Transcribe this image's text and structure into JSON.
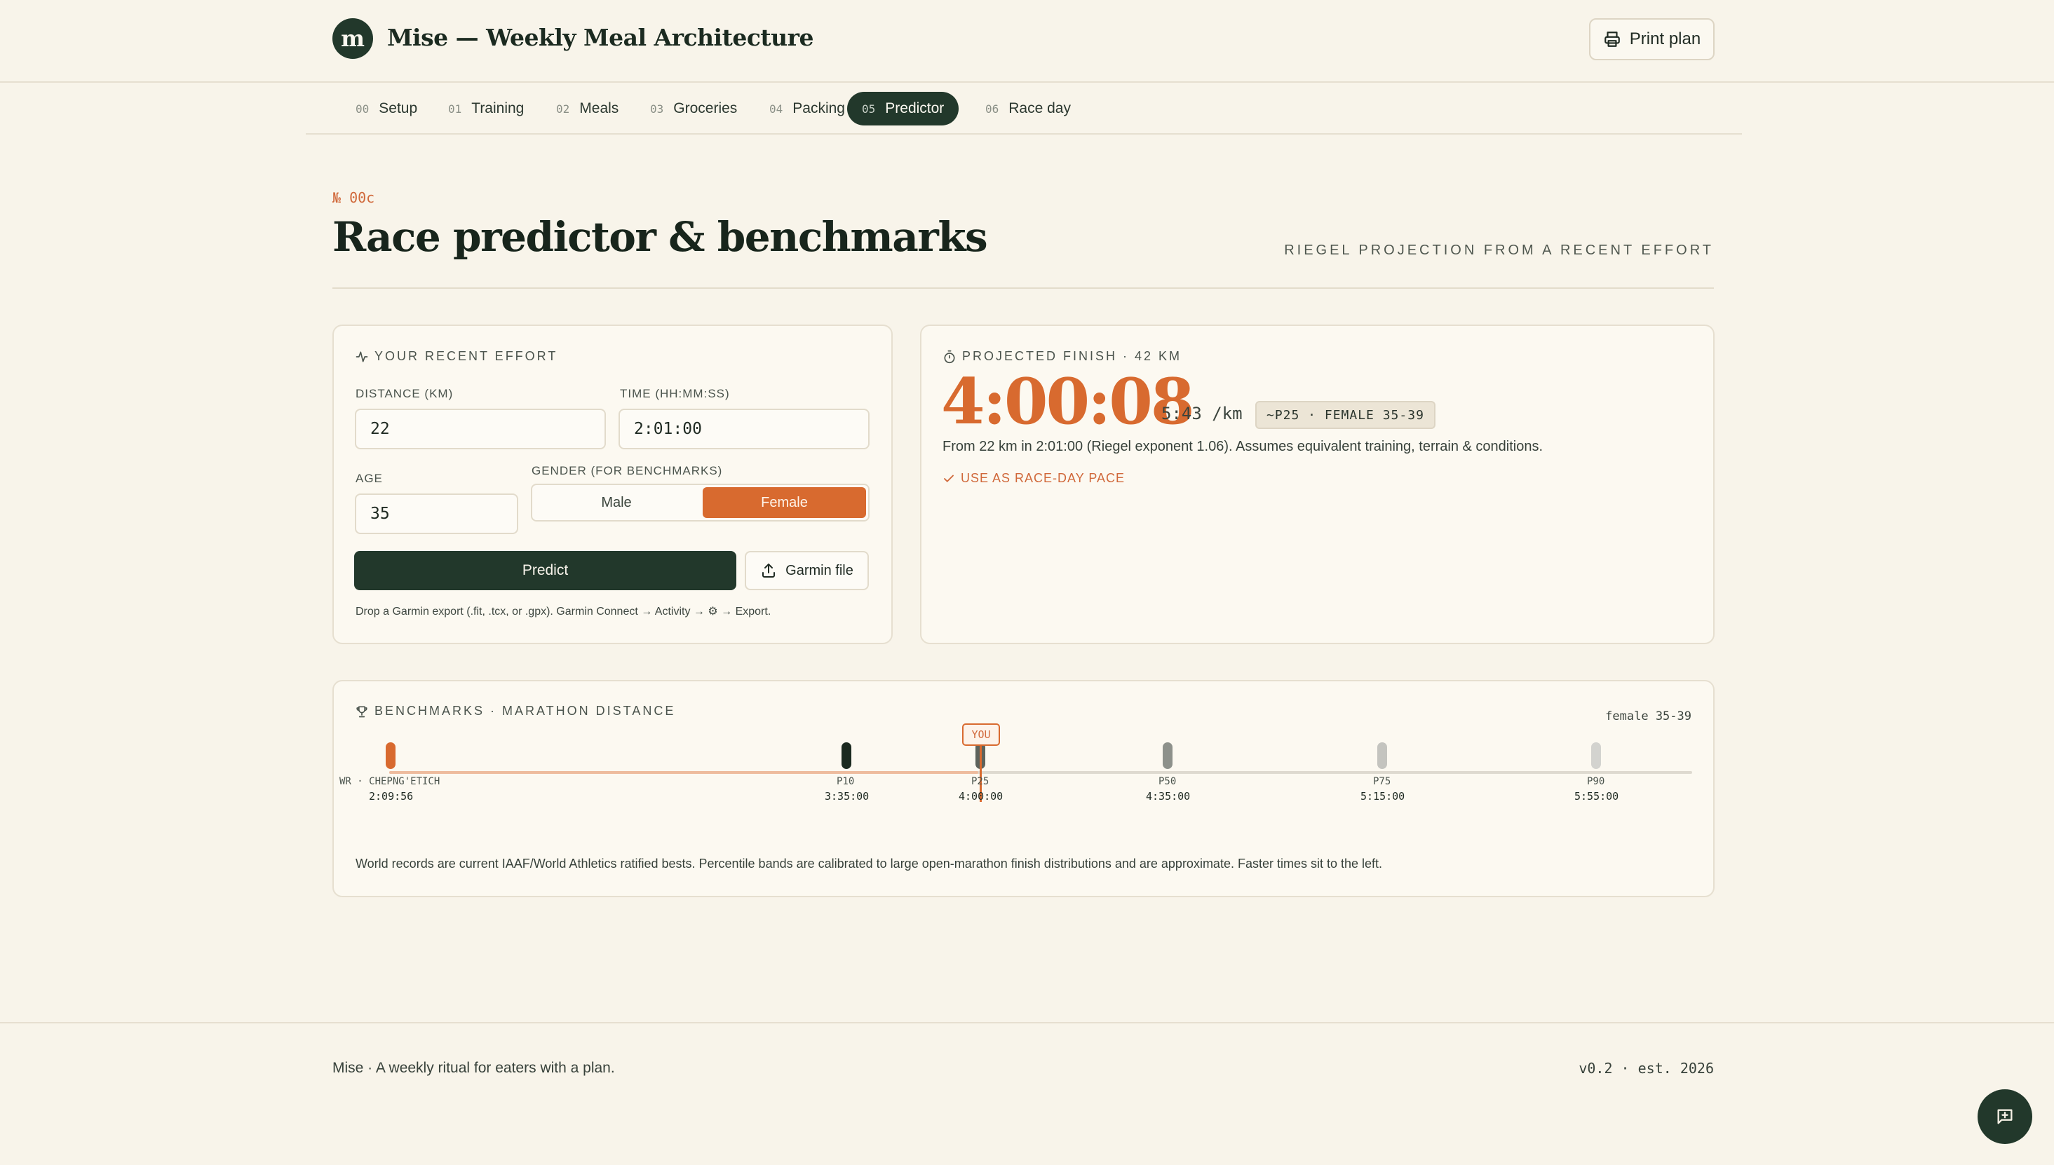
{
  "header": {
    "logo_letter": "m",
    "title": "Mise — Weekly Meal Architecture",
    "print_label": "Print plan"
  },
  "nav": {
    "tabs": [
      {
        "num": "00",
        "label": "Setup"
      },
      {
        "num": "01",
        "label": "Training"
      },
      {
        "num": "02",
        "label": "Meals"
      },
      {
        "num": "03",
        "label": "Groceries"
      },
      {
        "num": "04",
        "label": "Packing"
      },
      {
        "num": "05",
        "label": "Predictor",
        "active": true
      },
      {
        "num": "06",
        "label": "Race day"
      }
    ]
  },
  "page": {
    "section_no": "№ 00c",
    "title": "Race predictor & benchmarks",
    "subtitle": "RIEGEL PROJECTION FROM A RECENT EFFORT"
  },
  "effort": {
    "label": "YOUR RECENT EFFORT",
    "distance_label": "DISTANCE (KM)",
    "distance_value": "22",
    "time_label": "TIME (HH:MM:SS)",
    "time_value": "2:01:00",
    "age_label": "AGE",
    "age_value": "35",
    "gender_label": "GENDER (FOR BENCHMARKS)",
    "gender_options": [
      "Male",
      "Female"
    ],
    "gender_selected": "Female",
    "predict_label": "Predict",
    "garmin_label": "Garmin file",
    "hint": "Drop a Garmin export (.fit, .tcx, or .gpx). Garmin Connect → Activity → ⚙ → Export."
  },
  "projection": {
    "label": "PROJECTED FINISH · 42 KM",
    "finish_time": "4:00:08",
    "pace": "5:43 /km",
    "badge": "~P25 · FEMALE 35-39",
    "description": "From 22 km in 2:01:00 (Riegel exponent 1.06). Assumes equivalent training, terrain & conditions.",
    "use_label": "USE AS RACE-DAY PACE"
  },
  "benchmarks": {
    "label": "BENCHMARKS · MARATHON DISTANCE",
    "group": "female 35-39",
    "you_label": "YOU",
    "markers": [
      {
        "label": "WR · CHEPNG'ETICH",
        "time": "2:09:56",
        "color": "#d86a2f"
      },
      {
        "label": "P10",
        "time": "3:35:00",
        "color": "#1b2a20"
      },
      {
        "label": "P25",
        "time": "4:00:00",
        "color": "#5d635c"
      },
      {
        "label": "P50",
        "time": "4:35:00",
        "color": "#8d918b"
      },
      {
        "label": "P75",
        "time": "5:15:00",
        "color": "#c4c4bf"
      },
      {
        "label": "P90",
        "time": "5:55:00",
        "color": "#d3d3cf"
      }
    ],
    "note": "World records are current IAAF/World Athletics ratified bests. Percentile bands are calibrated to large open-marathon finish distributions and are approximate. Faster times sit to the left."
  },
  "footer": {
    "left": "Mise · A weekly ritual for eaters with a plan.",
    "right": "v0.2 · est. 2026"
  }
}
